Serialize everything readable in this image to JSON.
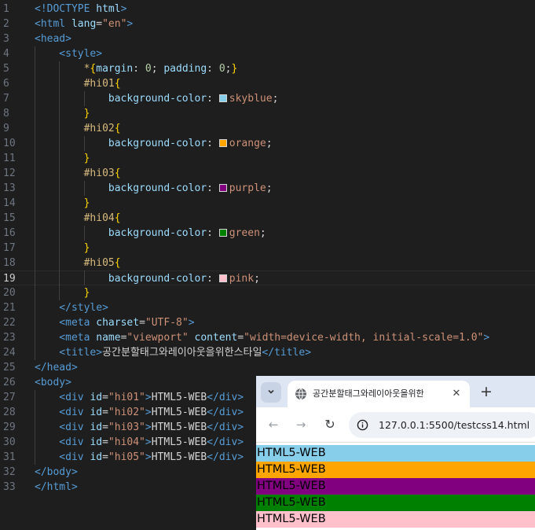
{
  "editor": {
    "current_line": "19",
    "lines": [
      {
        "n": "1",
        "indent": 0,
        "tokens": [
          [
            "tag",
            "<!DOCTYPE "
          ],
          [
            "attr",
            "html"
          ],
          [
            "tag",
            ">"
          ]
        ]
      },
      {
        "n": "2",
        "indent": 0,
        "tokens": [
          [
            "tag",
            "<html "
          ],
          [
            "attr",
            "lang"
          ],
          [
            "txt",
            "="
          ],
          [
            "str",
            "\"en\""
          ],
          [
            "tag",
            ">"
          ]
        ]
      },
      {
        "n": "3",
        "indent": 0,
        "tokens": [
          [
            "tag",
            "<head>"
          ]
        ]
      },
      {
        "n": "4",
        "indent": 1,
        "tokens": [
          [
            "tag",
            "<style>"
          ]
        ]
      },
      {
        "n": "5",
        "indent": 2,
        "tokens": [
          [
            "sel",
            "*"
          ],
          [
            "brace",
            "{"
          ],
          [
            "prop",
            "margin"
          ],
          [
            "txt",
            ": "
          ],
          [
            "num",
            "0"
          ],
          [
            "txt",
            "; "
          ],
          [
            "prop",
            "padding"
          ],
          [
            "txt",
            ": "
          ],
          [
            "num",
            "0"
          ],
          [
            "txt",
            ";"
          ],
          [
            "brace",
            "}"
          ]
        ]
      },
      {
        "n": "6",
        "indent": 2,
        "tokens": [
          [
            "sel",
            "#hi01"
          ],
          [
            "brace",
            "{"
          ]
        ]
      },
      {
        "n": "7",
        "indent": 3,
        "tokens": [
          [
            "prop",
            "background-color"
          ],
          [
            "txt",
            ": "
          ],
          [
            "swatch",
            "#87ceeb"
          ],
          [
            "str",
            "skyblue"
          ],
          [
            "txt",
            ";"
          ]
        ]
      },
      {
        "n": "8",
        "indent": 2,
        "tokens": [
          [
            "brace",
            "}"
          ]
        ]
      },
      {
        "n": "9",
        "indent": 2,
        "tokens": [
          [
            "sel",
            "#hi02"
          ],
          [
            "brace",
            "{"
          ]
        ]
      },
      {
        "n": "10",
        "indent": 3,
        "tokens": [
          [
            "prop",
            "background-color"
          ],
          [
            "txt",
            ": "
          ],
          [
            "swatch",
            "#ffa500"
          ],
          [
            "str",
            "orange"
          ],
          [
            "txt",
            ";"
          ]
        ]
      },
      {
        "n": "11",
        "indent": 2,
        "tokens": [
          [
            "brace",
            "}"
          ]
        ]
      },
      {
        "n": "12",
        "indent": 2,
        "tokens": [
          [
            "sel",
            "#hi03"
          ],
          [
            "brace",
            "{"
          ]
        ]
      },
      {
        "n": "13",
        "indent": 3,
        "tokens": [
          [
            "prop",
            "background-color"
          ],
          [
            "txt",
            ": "
          ],
          [
            "swatch",
            "#800080"
          ],
          [
            "str",
            "purple"
          ],
          [
            "txt",
            ";"
          ]
        ]
      },
      {
        "n": "14",
        "indent": 2,
        "tokens": [
          [
            "brace",
            "}"
          ]
        ]
      },
      {
        "n": "15",
        "indent": 2,
        "tokens": [
          [
            "sel",
            "#hi04"
          ],
          [
            "brace",
            "{"
          ]
        ]
      },
      {
        "n": "16",
        "indent": 3,
        "tokens": [
          [
            "prop",
            "background-color"
          ],
          [
            "txt",
            ": "
          ],
          [
            "swatch",
            "#008000"
          ],
          [
            "str",
            "green"
          ],
          [
            "txt",
            ";"
          ]
        ]
      },
      {
        "n": "17",
        "indent": 2,
        "tokens": [
          [
            "brace",
            "}"
          ]
        ]
      },
      {
        "n": "18",
        "indent": 2,
        "tokens": [
          [
            "sel",
            "#hi05"
          ],
          [
            "brace",
            "{"
          ]
        ]
      },
      {
        "n": "19",
        "indent": 3,
        "tokens": [
          [
            "prop",
            "background-color"
          ],
          [
            "txt",
            ": "
          ],
          [
            "swatch",
            "#ffc0cb"
          ],
          [
            "str",
            "pink"
          ],
          [
            "txt",
            ";"
          ]
        ]
      },
      {
        "n": "20",
        "indent": 2,
        "tokens": [
          [
            "brace",
            "}"
          ]
        ]
      },
      {
        "n": "21",
        "indent": 1,
        "tokens": [
          [
            "tag",
            "</style>"
          ]
        ]
      },
      {
        "n": "22",
        "indent": 1,
        "tokens": [
          [
            "tag",
            "<meta "
          ],
          [
            "attr",
            "charset"
          ],
          [
            "txt",
            "="
          ],
          [
            "str",
            "\"UTF-8\""
          ],
          [
            "tag",
            ">"
          ]
        ]
      },
      {
        "n": "23",
        "indent": 1,
        "tokens": [
          [
            "tag",
            "<meta "
          ],
          [
            "attr",
            "name"
          ],
          [
            "txt",
            "="
          ],
          [
            "str",
            "\"viewport\""
          ],
          [
            "attr",
            " content"
          ],
          [
            "txt",
            "="
          ],
          [
            "str",
            "\"width=device-width, initial-scale=1.0\""
          ],
          [
            "tag",
            ">"
          ]
        ]
      },
      {
        "n": "24",
        "indent": 1,
        "tokens": [
          [
            "tag",
            "<title>"
          ],
          [
            "txt",
            "공간분할태그와레이아웃을위한스타일"
          ],
          [
            "tag",
            "</title>"
          ]
        ]
      },
      {
        "n": "25",
        "indent": 0,
        "tokens": [
          [
            "tag",
            "</head>"
          ]
        ]
      },
      {
        "n": "26",
        "indent": 0,
        "tokens": [
          [
            "tag",
            "<body>"
          ]
        ]
      },
      {
        "n": "27",
        "indent": 1,
        "tokens": [
          [
            "tag",
            "<div "
          ],
          [
            "attr",
            "id"
          ],
          [
            "txt",
            "="
          ],
          [
            "str",
            "\"hi01\""
          ],
          [
            "tag",
            ">"
          ],
          [
            "txt",
            "HTML5-WEB"
          ],
          [
            "tag",
            "</div>"
          ]
        ]
      },
      {
        "n": "28",
        "indent": 1,
        "tokens": [
          [
            "tag",
            "<div "
          ],
          [
            "attr",
            "id"
          ],
          [
            "txt",
            "="
          ],
          [
            "str",
            "\"hi02\""
          ],
          [
            "tag",
            ">"
          ],
          [
            "txt",
            "HTML5-WEB"
          ],
          [
            "tag",
            "</div>"
          ]
        ]
      },
      {
        "n": "29",
        "indent": 1,
        "tokens": [
          [
            "tag",
            "<div "
          ],
          [
            "attr",
            "id"
          ],
          [
            "txt",
            "="
          ],
          [
            "str",
            "\"hi03\""
          ],
          [
            "tag",
            ">"
          ],
          [
            "txt",
            "HTML5-WEB"
          ],
          [
            "tag",
            "</div>"
          ]
        ]
      },
      {
        "n": "30",
        "indent": 1,
        "tokens": [
          [
            "tag",
            "<div "
          ],
          [
            "attr",
            "id"
          ],
          [
            "txt",
            "="
          ],
          [
            "str",
            "\"hi04\""
          ],
          [
            "tag",
            ">"
          ],
          [
            "txt",
            "HTML5-WEB"
          ],
          [
            "tag",
            "</div>"
          ]
        ]
      },
      {
        "n": "31",
        "indent": 1,
        "tokens": [
          [
            "tag",
            "<div "
          ],
          [
            "attr",
            "id"
          ],
          [
            "txt",
            "="
          ],
          [
            "str",
            "\"hi05\""
          ],
          [
            "tag",
            ">"
          ],
          [
            "txt",
            "HTML5-WEB"
          ],
          [
            "tag",
            "</div>"
          ]
        ]
      },
      {
        "n": "32",
        "indent": 0,
        "tokens": [
          [
            "tag",
            "</body>"
          ]
        ]
      },
      {
        "n": "33",
        "indent": 0,
        "tokens": [
          [
            "tag",
            "</html>"
          ]
        ]
      }
    ]
  },
  "browser": {
    "tab_title": "공간분할태그와레이아웃을위한",
    "tab_close": "✕",
    "new_tab": "+",
    "tab_search_icon": "chevron-down-icon",
    "back": "←",
    "forward": "→",
    "reload": "↻",
    "url": "127.0.0.1:5500/testcss14.html",
    "blocks": [
      {
        "text": "HTML5-WEB",
        "color": "#87ceeb"
      },
      {
        "text": "HTML5-WEB",
        "color": "#ffa500"
      },
      {
        "text": "HTML5-WEB",
        "color": "#800080"
      },
      {
        "text": "HTML5-WEB",
        "color": "#008000"
      },
      {
        "text": "HTML5-WEB",
        "color": "#ffc0cb"
      }
    ]
  }
}
